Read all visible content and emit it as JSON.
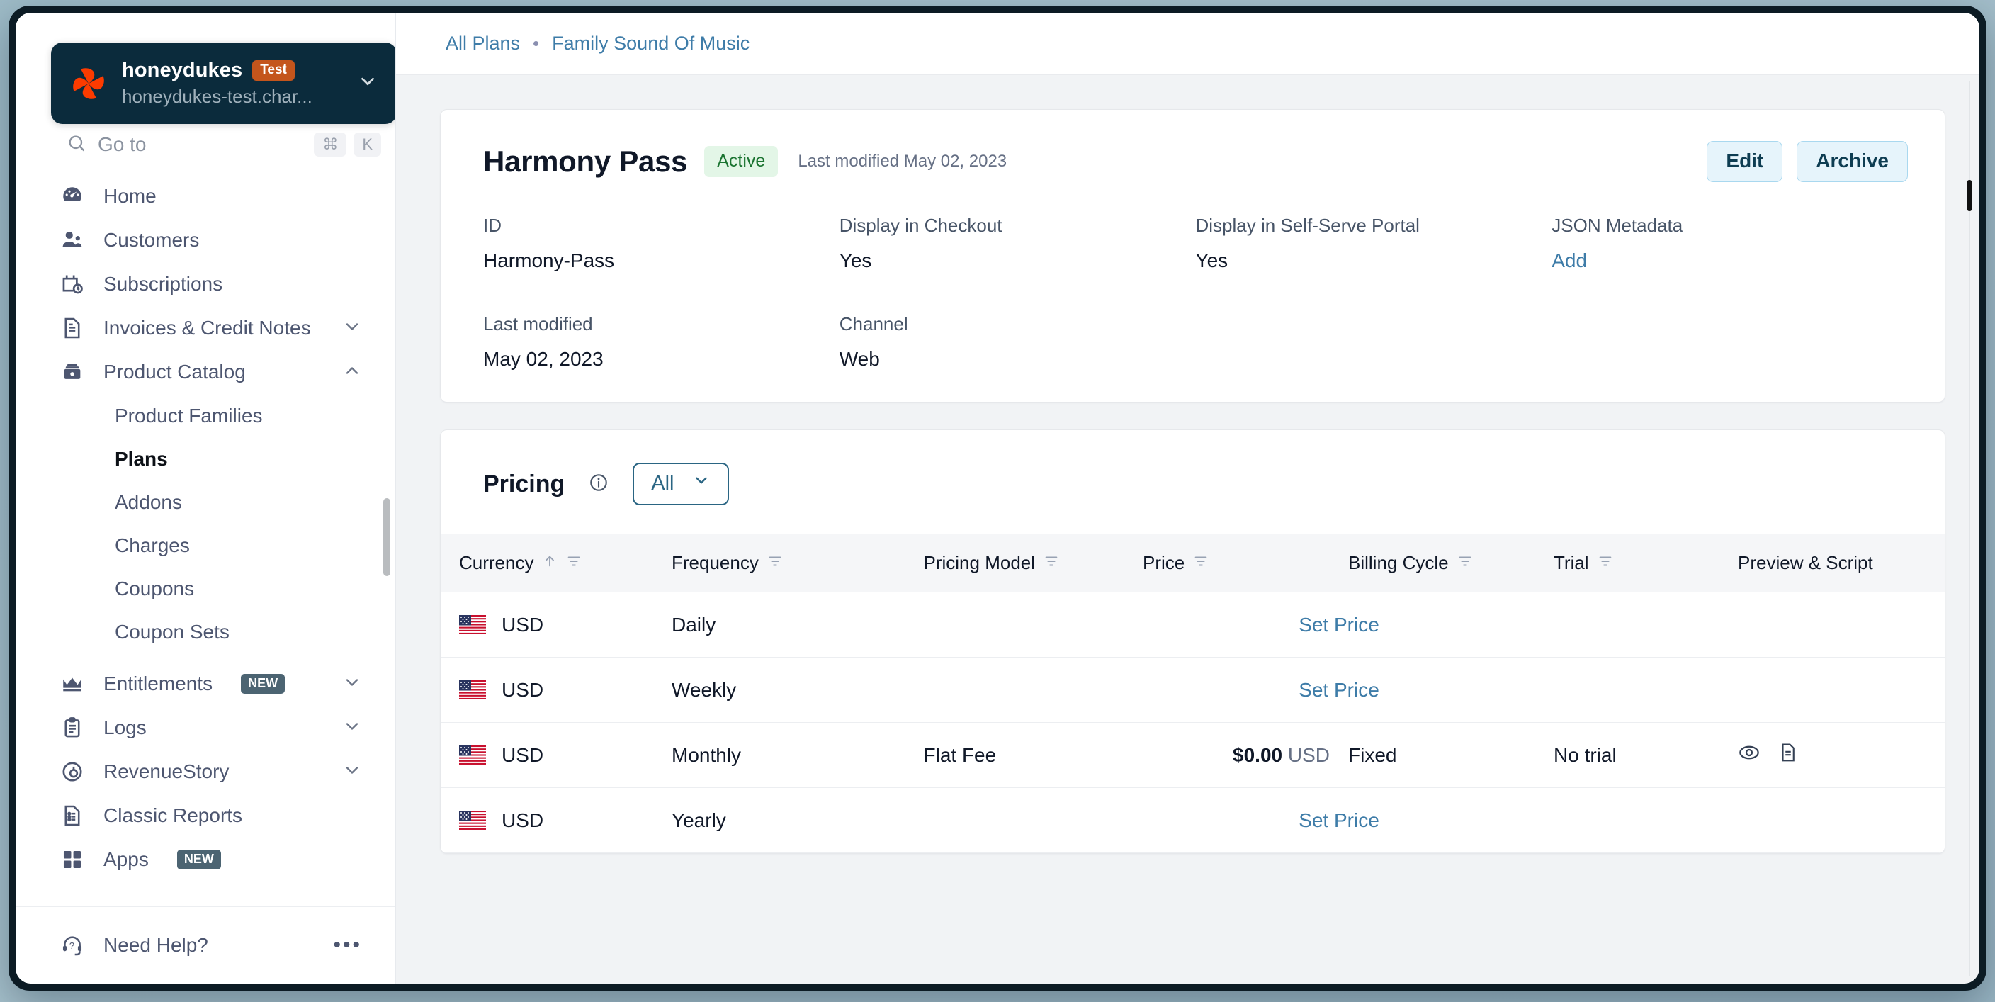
{
  "org": {
    "name": "honeydukes",
    "env_badge": "Test",
    "domain": "honeydukes-test.char...",
    "chevron_icon": "chevron-down-icon",
    "logo_icon": "chargebee-logo-icon",
    "logo_color": "#fc3b00",
    "badge_color": "#c4551c"
  },
  "goto": {
    "label": "Go to",
    "keys": [
      "⌘",
      "K"
    ]
  },
  "sidebar": {
    "items": [
      {
        "label": "Home",
        "icon": "speedometer-icon",
        "expandable": false,
        "badge": null
      },
      {
        "label": "Customers",
        "icon": "customers-icon",
        "expandable": false,
        "badge": null
      },
      {
        "label": "Subscriptions",
        "icon": "calendar-clock-icon",
        "expandable": false,
        "badge": null
      },
      {
        "label": "Invoices & Credit Notes",
        "icon": "invoice-icon",
        "expandable": true,
        "expanded": false,
        "badge": null
      },
      {
        "label": "Product Catalog",
        "icon": "catalog-box-icon",
        "expandable": true,
        "expanded": true,
        "badge": null
      }
    ],
    "product_catalog_children": [
      {
        "label": "Product Families",
        "active": false
      },
      {
        "label": "Plans",
        "active": true
      },
      {
        "label": "Addons",
        "active": false
      },
      {
        "label": "Charges",
        "active": false
      },
      {
        "label": "Coupons",
        "active": false
      },
      {
        "label": "Coupon Sets",
        "active": false
      }
    ],
    "items_after": [
      {
        "label": "Entitlements",
        "icon": "crown-icon",
        "expandable": true,
        "expanded": false,
        "badge": "NEW"
      },
      {
        "label": "Logs",
        "icon": "clipboard-icon",
        "expandable": true,
        "expanded": false,
        "badge": null
      },
      {
        "label": "RevenueStory",
        "icon": "revenuestory-icon",
        "expandable": true,
        "expanded": false,
        "badge": null
      },
      {
        "label": "Classic Reports",
        "icon": "report-doc-icon",
        "expandable": false,
        "badge": null
      },
      {
        "label": "Apps",
        "icon": "grid-apps-icon",
        "expandable": false,
        "badge": "NEW"
      }
    ],
    "footer": {
      "label": "Need Help?",
      "icon": "headset-help-icon",
      "more_icon": "ellipsis-icon"
    }
  },
  "breadcrumb": {
    "items": [
      {
        "label": "All Plans"
      },
      {
        "label": "Family Sound Of Music"
      }
    ],
    "separator": "•"
  },
  "plan": {
    "title": "Harmony Pass",
    "status": "Active",
    "last_modified_inline": "Last modified May 02, 2023",
    "actions": {
      "edit_label": "Edit",
      "archive_label": "Archive"
    },
    "fields": [
      {
        "label": "ID",
        "value": "Harmony-Pass",
        "link": false
      },
      {
        "label": "Display in Checkout",
        "value": "Yes",
        "link": false
      },
      {
        "label": "Display in Self-Serve Portal",
        "value": "Yes",
        "link": false
      },
      {
        "label": "JSON Metadata",
        "value": "Add",
        "link": true
      },
      {
        "label": "Last modified",
        "value": "May 02, 2023",
        "link": false
      },
      {
        "label": "Channel",
        "value": "Web",
        "link": false
      }
    ]
  },
  "pricing": {
    "title": "Pricing",
    "info_icon": "info-circle-icon",
    "filter": {
      "value": "All",
      "chevron_icon": "chevron-down-icon"
    },
    "columns": [
      {
        "label": "Currency",
        "sorted": "asc",
        "filter_icon": "column-filter-icon"
      },
      {
        "label": "Frequency",
        "sorted": null,
        "filter_icon": "column-filter-icon"
      },
      {
        "label": "Pricing Model",
        "sorted": null,
        "filter_icon": "column-filter-icon"
      },
      {
        "label": "Price",
        "sorted": null,
        "filter_icon": "column-filter-icon"
      },
      {
        "label": "Billing Cycle",
        "sorted": null,
        "filter_icon": "column-filter-icon"
      },
      {
        "label": "Trial",
        "sorted": null,
        "filter_icon": "column-filter-icon"
      },
      {
        "label": "Preview & Script",
        "sorted": null,
        "filter_icon": null
      }
    ],
    "rows": [
      {
        "currency": "USD",
        "flag": "us-flag-icon",
        "frequency": "Daily",
        "pricing_model": "",
        "price_amount": "",
        "price_currency": "",
        "set_price_label": "Set Price",
        "billing_cycle": "",
        "trial": "",
        "has_actions": false
      },
      {
        "currency": "USD",
        "flag": "us-flag-icon",
        "frequency": "Weekly",
        "pricing_model": "",
        "price_amount": "",
        "price_currency": "",
        "set_price_label": "Set Price",
        "billing_cycle": "",
        "trial": "",
        "has_actions": false
      },
      {
        "currency": "USD",
        "flag": "us-flag-icon",
        "frequency": "Monthly",
        "pricing_model": "Flat Fee",
        "price_amount": "$0.00",
        "price_currency": "USD",
        "set_price_label": null,
        "billing_cycle": "Fixed",
        "trial": "No trial",
        "has_actions": true
      },
      {
        "currency": "USD",
        "flag": "us-flag-icon",
        "frequency": "Yearly",
        "pricing_model": "",
        "price_amount": "",
        "price_currency": "",
        "set_price_label": "Set Price",
        "billing_cycle": "",
        "trial": "",
        "has_actions": false
      }
    ],
    "row_action_icons": [
      "preview-eye-icon",
      "script-doc-icon"
    ],
    "row_menu_icon": "kebab-menu-icon"
  },
  "colors": {
    "accent_link": "#3e7ca8",
    "status_active_bg": "#e3f6e7",
    "status_active_text": "#1b7431",
    "sidebar_text": "#4d5670",
    "brand_dark": "#0b2b3c"
  }
}
